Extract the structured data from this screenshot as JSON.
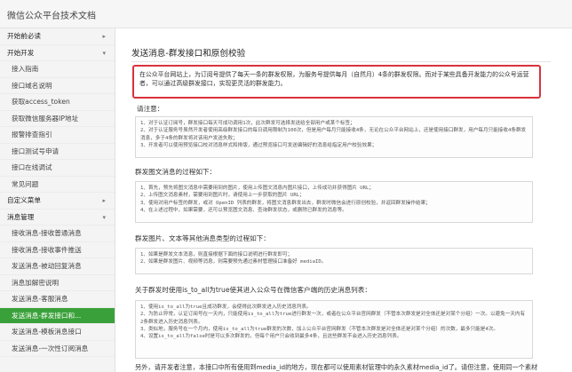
{
  "header": {
    "title": "微信公众平台技术文档"
  },
  "sidebar": {
    "items": [
      {
        "label": "开始前必读",
        "kind": "group",
        "caret": "▸"
      },
      {
        "label": "开始开发",
        "kind": "group",
        "caret": "▾"
      },
      {
        "label": "接入指南",
        "kind": "child"
      },
      {
        "label": "接口域名说明",
        "kind": "child"
      },
      {
        "label": "获取access_token",
        "kind": "child"
      },
      {
        "label": "获取微信服务器IP地址",
        "kind": "child"
      },
      {
        "label": "报警排查指引",
        "kind": "child"
      },
      {
        "label": "接口测试号申请",
        "kind": "child"
      },
      {
        "label": "接口在线调试",
        "kind": "child"
      },
      {
        "label": "常见问题",
        "kind": "child"
      },
      {
        "label": "自定义菜单",
        "kind": "group",
        "caret": "▸"
      },
      {
        "label": "消息管理",
        "kind": "group",
        "caret": "▾"
      },
      {
        "label": "接收消息-接收普通消息",
        "kind": "child"
      },
      {
        "label": "接收消息-接收事件推送",
        "kind": "child"
      },
      {
        "label": "发送消息-被动回复消息",
        "kind": "child"
      },
      {
        "label": "消息加解密说明",
        "kind": "child"
      },
      {
        "label": "发送消息-客服消息",
        "kind": "child"
      },
      {
        "label": "发送消息-群发接口和...",
        "kind": "child",
        "active": true
      },
      {
        "label": "发送消息-模板消息接口",
        "kind": "child"
      },
      {
        "label": "发送消息-一次性订阅消息",
        "kind": "child"
      }
    ]
  },
  "main": {
    "title": "发送消息-群发接口和原创校验",
    "intro": "在公众平台网站上，为订阅号提供了每天一条的群发权限，为服务号提供每月（自然月）4条的群发权限。而对于某些具备开发能力的公众号运营者，可以通过高级群发接口，实现更灵活的群发能力。",
    "notice_label": "请注意：",
    "notice_lines": [
      "1、对于认证订阅号，群发接口每天可成功调用1次，此次群发可选择发送给全部用户或某个标签；",
      "2、对于认证服务号虽然开发者使用高级群发接口的每日调用限制为100次，但是用户每月只能接收4条，无论在公众平台网站上，还是使用接口群发，用户每月只能接收4条群发消息，多于4条的群发将对该用户发送失败；",
      "3、开发者可以使用预览接口校对消息样式和排版，通过预览接口可发送编辑好的消息给指定用户校验效果；"
    ],
    "process_label": "群发图文消息的过程如下：",
    "process_lines": [
      "1、首先，预先将图文消息中需要用到的图片，使用上传图文消息内图片接口，上传成功并获得图片 URL；",
      "2、上传图文消息素材，需要用到图片时，请使用上一步获取的图片 URL；",
      "3、使用对用户标签的群发，或对 OpenID 列表的群发，将图文消息群发出去，群发时微信会进行原创校验，并返回群发操作结果；",
      "4、在上述过程中，如果需要，还可以预览图文消息、查询群发状态，或删除已群发的消息等。"
    ],
    "image_label": "群发图片、文本等其他消息类型的过程如下：",
    "image_lines": [
      "1、如果是群发文本消息，则直接根据下面的接口说明进行群发即可；",
      "2、如果是群发图片、视频等消息，则需要预先通过素材管理接口准备好 mediaID。"
    ],
    "history_label": "关于群发时使用is_to_all为true使其进入公众号在微信客户端的历史消息列表：",
    "history_lines": [
      "1、使用is_to_all为true且成功群发，会使得此次群发进入历史消息列表。",
      "2、为防止异常，认证订阅号在一天内，只能使用is_to_all为true进行群发一次，或者在公众平台官网群发（不管本次群发是对全体还是对某个分组）一次。以避免一天内有2条群发进入历史消息列表。",
      "3、类似地，服务号在一个月内，使用is_to_all为true群发的次数，加上公众平台官网群发（不管本次群发是对全体还是对某个分组）的次数，最多只能是4次。",
      "4、设置is_to_all为false时是可以多次群发的，但每个用户只会收到最多4条，且这些群发不会进入历史消息列表。"
    ],
    "footer_text": "另外，请开发者注意，本接口中所有使用到media_id的地方，现在都可以使用素材管理中的永久素材media_id了。请但注意，使用同一个素材"
  }
}
